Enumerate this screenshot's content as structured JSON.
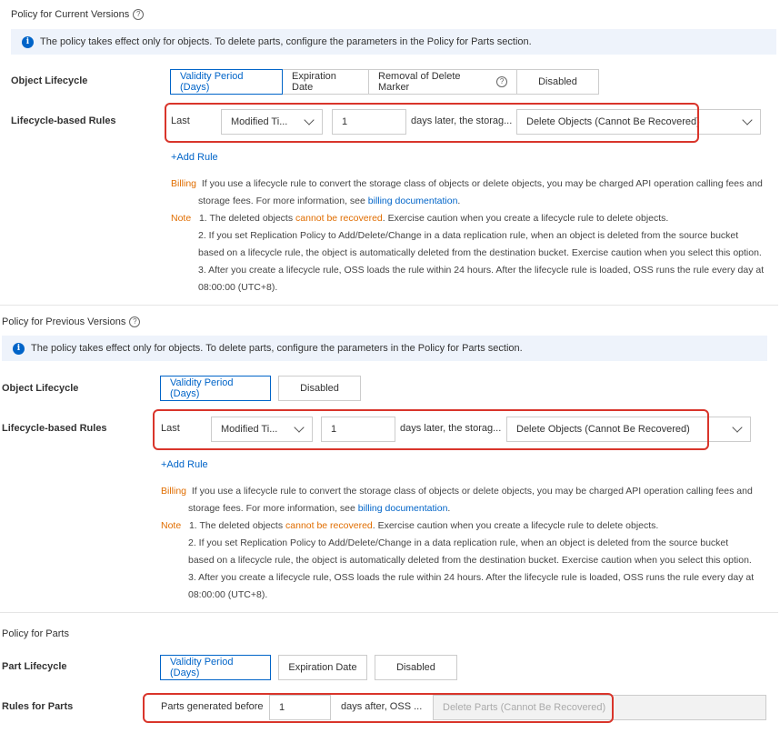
{
  "current": {
    "title": "Policy for Current Versions",
    "info": "The policy takes effect only for objects. To delete parts, configure the parameters in the Policy for Parts section.",
    "object_lifecycle_label": "Object Lifecycle",
    "options": [
      "Validity Period (Days)",
      "Expiration Date",
      "Removal of Delete Marker",
      "Disabled"
    ],
    "rules_label": "Lifecycle-based Rules",
    "last": "Last",
    "field_select": "Modified Ti...",
    "days_value": "1",
    "days_text": "days later, the storag...",
    "action_select": "Delete Objects (Cannot Be Recovered)",
    "add_rule": "+Add Rule"
  },
  "previous": {
    "title": "Policy for Previous Versions",
    "info": "The policy takes effect only for objects. To delete parts, configure the parameters in the Policy for Parts section.",
    "object_lifecycle_label": "Object Lifecycle",
    "options": [
      "Validity Period (Days)",
      "Disabled"
    ],
    "rules_label": "Lifecycle-based Rules",
    "last": "Last",
    "field_select": "Modified Ti...",
    "days_value": "1",
    "days_text": "days later, the storag...",
    "action_select": "Delete Objects (Cannot Be Recovered)",
    "add_rule": "+Add Rule"
  },
  "notes": {
    "billing_label": "Billing",
    "billing_text": "If you use a lifecycle rule to convert the storage class of objects or delete objects, you may be charged API operation calling fees and",
    "billing_text2": "storage fees. For more information, see",
    "billing_link": "billing documentation",
    "billing_end": ".",
    "note_label": "Note",
    "note1_a": "1. The deleted objects",
    "note1_b": "cannot be recovered",
    "note1_c": ". Exercise caution when you create a lifecycle rule to delete objects.",
    "note2_a": "2. If you set Replication Policy to Add/Delete/Change in a data replication rule, when an object is deleted from the source bucket",
    "note2_b": "based on a lifecycle rule, the object is automatically deleted from the destination bucket. Exercise caution when you select this option.",
    "note3_a": "3. After you create a lifecycle rule, OSS loads the rule within 24 hours. After the lifecycle rule is loaded, OSS runs the rule every day at",
    "note3_b": "08:00:00 (UTC+8)."
  },
  "parts": {
    "title": "Policy for Parts",
    "part_lifecycle_label": "Part Lifecycle",
    "options": [
      "Validity Period (Days)",
      "Expiration Date",
      "Disabled"
    ],
    "rules_label": "Rules for Parts",
    "generated_before": "Parts generated before",
    "days_value": "1",
    "days_text": "days after, OSS ...",
    "action": "Delete Parts (Cannot Be Recovered)"
  },
  "colors": {
    "accent": "#0064c8",
    "warning": "#e06d00",
    "highlight_red": "#d9352b"
  }
}
